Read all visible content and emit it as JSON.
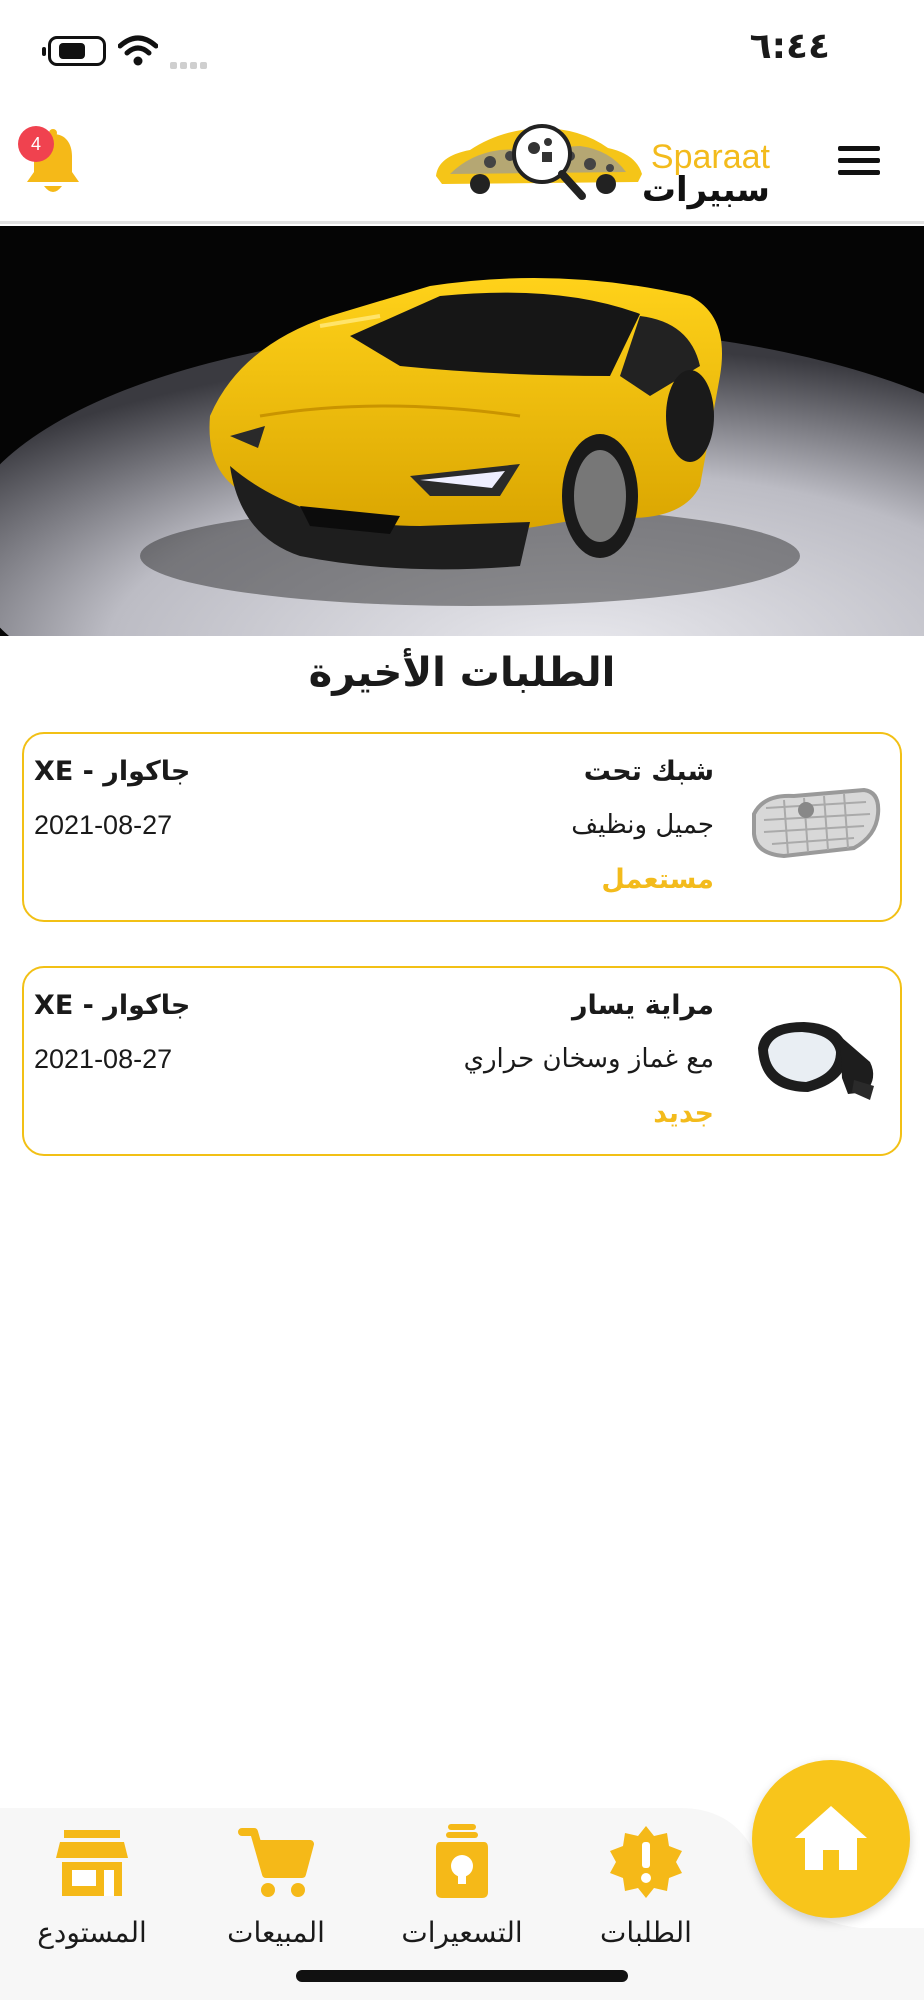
{
  "status_bar": {
    "time": "٦:٤٤"
  },
  "header": {
    "notification_count": "4",
    "logo_text_en": "Sparaat",
    "logo_text_ar": "سبيرات",
    "accent_color": "#f3bb1c"
  },
  "section": {
    "title": "الطلبات الأخيرة"
  },
  "requests": [
    {
      "part_name": "شبك تحت",
      "description": "جميل ونظيف",
      "condition": "مستعمل",
      "car_model": "جاكوار - XE",
      "date": "2021-08-27",
      "thumbnail_icon": "grille-icon"
    },
    {
      "part_name": "مراية يسار",
      "description": "مع غماز وسخان حراري",
      "condition": "جديد",
      "car_model": "جاكوار - XE",
      "date": "2021-08-27",
      "thumbnail_icon": "side-mirror-icon"
    }
  ],
  "bottom_nav": {
    "items": [
      {
        "label": "الطلبات",
        "icon": "alert-badge-icon"
      },
      {
        "label": "التسعيرات",
        "icon": "price-tag-icon"
      },
      {
        "label": "المبيعات",
        "icon": "cart-icon"
      },
      {
        "label": "المستودع",
        "icon": "store-icon"
      }
    ],
    "home_icon": "home-icon"
  }
}
